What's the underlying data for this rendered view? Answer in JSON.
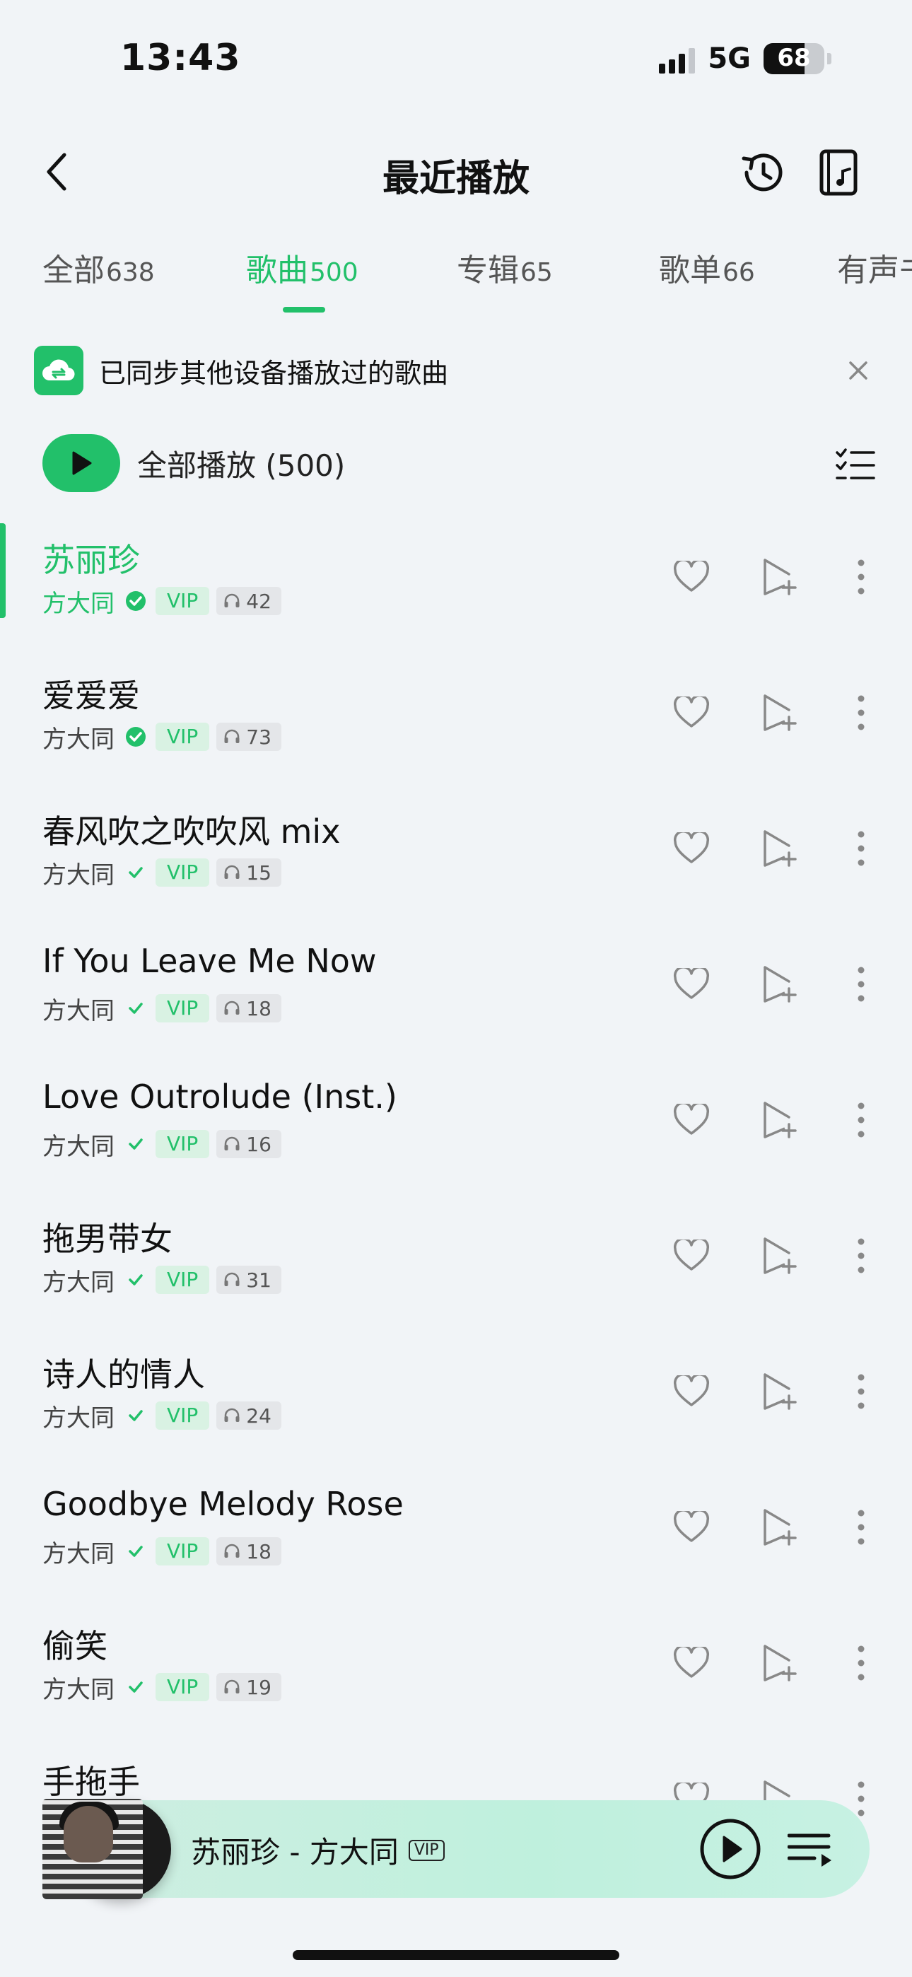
{
  "status_bar": {
    "time": "13:43",
    "network": "5G",
    "battery": "68",
    "battery_level": 0.68
  },
  "header": {
    "title": "最近播放"
  },
  "tabs": [
    {
      "label": "全部",
      "count": "638"
    },
    {
      "label": "歌曲",
      "count": "500"
    },
    {
      "label": "专辑",
      "count": "65"
    },
    {
      "label": "歌单",
      "count": "66"
    },
    {
      "label": "有声书",
      "count": ""
    }
  ],
  "active_tab": "歌曲",
  "sync_banner": {
    "text": "已同步其他设备播放过的歌曲"
  },
  "play_all": {
    "label": "全部播放 (500)"
  },
  "songs": [
    {
      "title": "苏丽珍",
      "artist": "方大同",
      "vip": "VIP",
      "plays": "42",
      "playing": true
    },
    {
      "title": "爱爱爱",
      "artist": "方大同",
      "vip": "VIP",
      "plays": "73",
      "playing": false
    },
    {
      "title": "春风吹之吹吹风 mix",
      "artist": "方大同",
      "vip": "VIP",
      "plays": "15",
      "playing": false
    },
    {
      "title": "If You Leave Me Now",
      "artist": "方大同",
      "vip": "VIP",
      "plays": "18",
      "playing": false
    },
    {
      "title": "Love Outrolude (Inst.)",
      "artist": "方大同",
      "vip": "VIP",
      "plays": "16",
      "playing": false
    },
    {
      "title": "拖男带女",
      "artist": "方大同",
      "vip": "VIP",
      "plays": "31",
      "playing": false
    },
    {
      "title": "诗人的情人",
      "artist": "方大同",
      "vip": "VIP",
      "plays": "24",
      "playing": false
    },
    {
      "title": "Goodbye Melody Rose",
      "artist": "方大同",
      "vip": "VIP",
      "plays": "18",
      "playing": false
    },
    {
      "title": "偷笑",
      "artist": "方大同",
      "vip": "VIP",
      "plays": "19",
      "playing": false
    },
    {
      "title": "手拖手",
      "artist": "",
      "vip": "",
      "plays": "",
      "playing": false
    }
  ],
  "mini_player": {
    "title": "苏丽珍 - 方大同",
    "vip": "VIP"
  },
  "colors": {
    "accent": "#22c06a",
    "background": "#f1f4f7",
    "vip_bg": "#d9f2e3"
  },
  "icons": {
    "header": [
      "back-icon",
      "history-icon",
      "local-music-icon"
    ],
    "row_actions": [
      "heart-icon",
      "add-to-playlist-icon",
      "more-icon"
    ],
    "mini_player": [
      "play-icon",
      "playlist-queue-icon"
    ]
  }
}
